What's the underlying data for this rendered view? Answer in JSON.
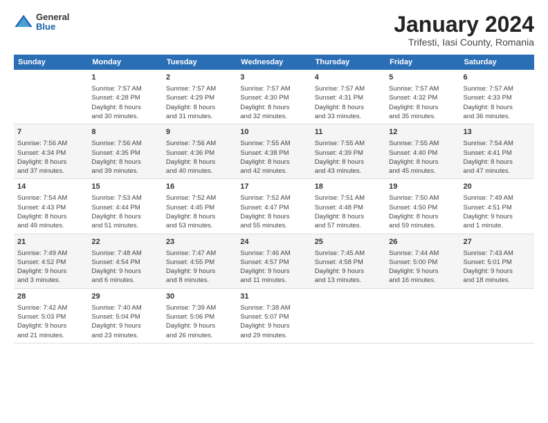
{
  "header": {
    "logo_general": "General",
    "logo_blue": "Blue",
    "title": "January 2024",
    "subtitle": "Trifesti, Iasi County, Romania"
  },
  "calendar": {
    "days_of_week": [
      "Sunday",
      "Monday",
      "Tuesday",
      "Wednesday",
      "Thursday",
      "Friday",
      "Saturday"
    ],
    "weeks": [
      [
        {
          "num": "",
          "info": ""
        },
        {
          "num": "1",
          "info": "Sunrise: 7:57 AM\nSunset: 4:28 PM\nDaylight: 8 hours\nand 30 minutes."
        },
        {
          "num": "2",
          "info": "Sunrise: 7:57 AM\nSunset: 4:29 PM\nDaylight: 8 hours\nand 31 minutes."
        },
        {
          "num": "3",
          "info": "Sunrise: 7:57 AM\nSunset: 4:30 PM\nDaylight: 8 hours\nand 32 minutes."
        },
        {
          "num": "4",
          "info": "Sunrise: 7:57 AM\nSunset: 4:31 PM\nDaylight: 8 hours\nand 33 minutes."
        },
        {
          "num": "5",
          "info": "Sunrise: 7:57 AM\nSunset: 4:32 PM\nDaylight: 8 hours\nand 35 minutes."
        },
        {
          "num": "6",
          "info": "Sunrise: 7:57 AM\nSunset: 4:33 PM\nDaylight: 8 hours\nand 36 minutes."
        }
      ],
      [
        {
          "num": "7",
          "info": "Sunrise: 7:56 AM\nSunset: 4:34 PM\nDaylight: 8 hours\nand 37 minutes."
        },
        {
          "num": "8",
          "info": "Sunrise: 7:56 AM\nSunset: 4:35 PM\nDaylight: 8 hours\nand 39 minutes."
        },
        {
          "num": "9",
          "info": "Sunrise: 7:56 AM\nSunset: 4:36 PM\nDaylight: 8 hours\nand 40 minutes."
        },
        {
          "num": "10",
          "info": "Sunrise: 7:55 AM\nSunset: 4:38 PM\nDaylight: 8 hours\nand 42 minutes."
        },
        {
          "num": "11",
          "info": "Sunrise: 7:55 AM\nSunset: 4:39 PM\nDaylight: 8 hours\nand 43 minutes."
        },
        {
          "num": "12",
          "info": "Sunrise: 7:55 AM\nSunset: 4:40 PM\nDaylight: 8 hours\nand 45 minutes."
        },
        {
          "num": "13",
          "info": "Sunrise: 7:54 AM\nSunset: 4:41 PM\nDaylight: 8 hours\nand 47 minutes."
        }
      ],
      [
        {
          "num": "14",
          "info": "Sunrise: 7:54 AM\nSunset: 4:43 PM\nDaylight: 8 hours\nand 49 minutes."
        },
        {
          "num": "15",
          "info": "Sunrise: 7:53 AM\nSunset: 4:44 PM\nDaylight: 8 hours\nand 51 minutes."
        },
        {
          "num": "16",
          "info": "Sunrise: 7:52 AM\nSunset: 4:45 PM\nDaylight: 8 hours\nand 53 minutes."
        },
        {
          "num": "17",
          "info": "Sunrise: 7:52 AM\nSunset: 4:47 PM\nDaylight: 8 hours\nand 55 minutes."
        },
        {
          "num": "18",
          "info": "Sunrise: 7:51 AM\nSunset: 4:48 PM\nDaylight: 8 hours\nand 57 minutes."
        },
        {
          "num": "19",
          "info": "Sunrise: 7:50 AM\nSunset: 4:50 PM\nDaylight: 8 hours\nand 59 minutes."
        },
        {
          "num": "20",
          "info": "Sunrise: 7:49 AM\nSunset: 4:51 PM\nDaylight: 9 hours\nand 1 minute."
        }
      ],
      [
        {
          "num": "21",
          "info": "Sunrise: 7:49 AM\nSunset: 4:52 PM\nDaylight: 9 hours\nand 3 minutes."
        },
        {
          "num": "22",
          "info": "Sunrise: 7:48 AM\nSunset: 4:54 PM\nDaylight: 9 hours\nand 6 minutes."
        },
        {
          "num": "23",
          "info": "Sunrise: 7:47 AM\nSunset: 4:55 PM\nDaylight: 9 hours\nand 8 minutes."
        },
        {
          "num": "24",
          "info": "Sunrise: 7:46 AM\nSunset: 4:57 PM\nDaylight: 9 hours\nand 11 minutes."
        },
        {
          "num": "25",
          "info": "Sunrise: 7:45 AM\nSunset: 4:58 PM\nDaylight: 9 hours\nand 13 minutes."
        },
        {
          "num": "26",
          "info": "Sunrise: 7:44 AM\nSunset: 5:00 PM\nDaylight: 9 hours\nand 16 minutes."
        },
        {
          "num": "27",
          "info": "Sunrise: 7:43 AM\nSunset: 5:01 PM\nDaylight: 9 hours\nand 18 minutes."
        }
      ],
      [
        {
          "num": "28",
          "info": "Sunrise: 7:42 AM\nSunset: 5:03 PM\nDaylight: 9 hours\nand 21 minutes."
        },
        {
          "num": "29",
          "info": "Sunrise: 7:40 AM\nSunset: 5:04 PM\nDaylight: 9 hours\nand 23 minutes."
        },
        {
          "num": "30",
          "info": "Sunrise: 7:39 AM\nSunset: 5:06 PM\nDaylight: 9 hours\nand 26 minutes."
        },
        {
          "num": "31",
          "info": "Sunrise: 7:38 AM\nSunset: 5:07 PM\nDaylight: 9 hours\nand 29 minutes."
        },
        {
          "num": "",
          "info": ""
        },
        {
          "num": "",
          "info": ""
        },
        {
          "num": "",
          "info": ""
        }
      ]
    ]
  }
}
